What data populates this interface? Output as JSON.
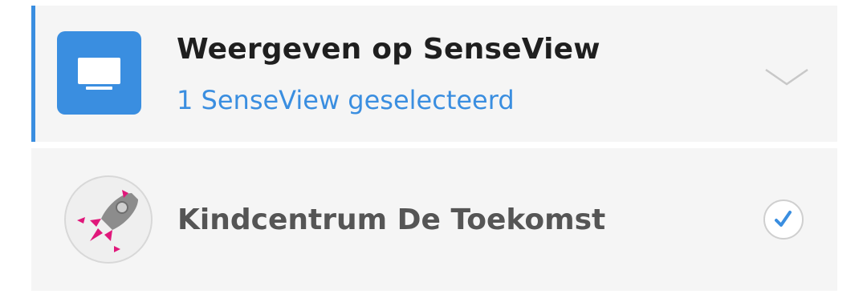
{
  "panel": {
    "title": "Weergeven op SenseView",
    "subtitle": "1 SenseView geselecteerd",
    "icon": "tv-icon",
    "expand_icon": "chevron-down-icon",
    "accent_color": "#3a8ee0"
  },
  "items": [
    {
      "label": "Kindcentrum De Toekomst",
      "avatar_icon": "rocket-icon",
      "selected": true,
      "status_icon": "checkmark-icon"
    }
  ],
  "colors": {
    "accent": "#3a8ee0",
    "background": "#f5f5f5",
    "rocket_accent": "#e0177a"
  }
}
